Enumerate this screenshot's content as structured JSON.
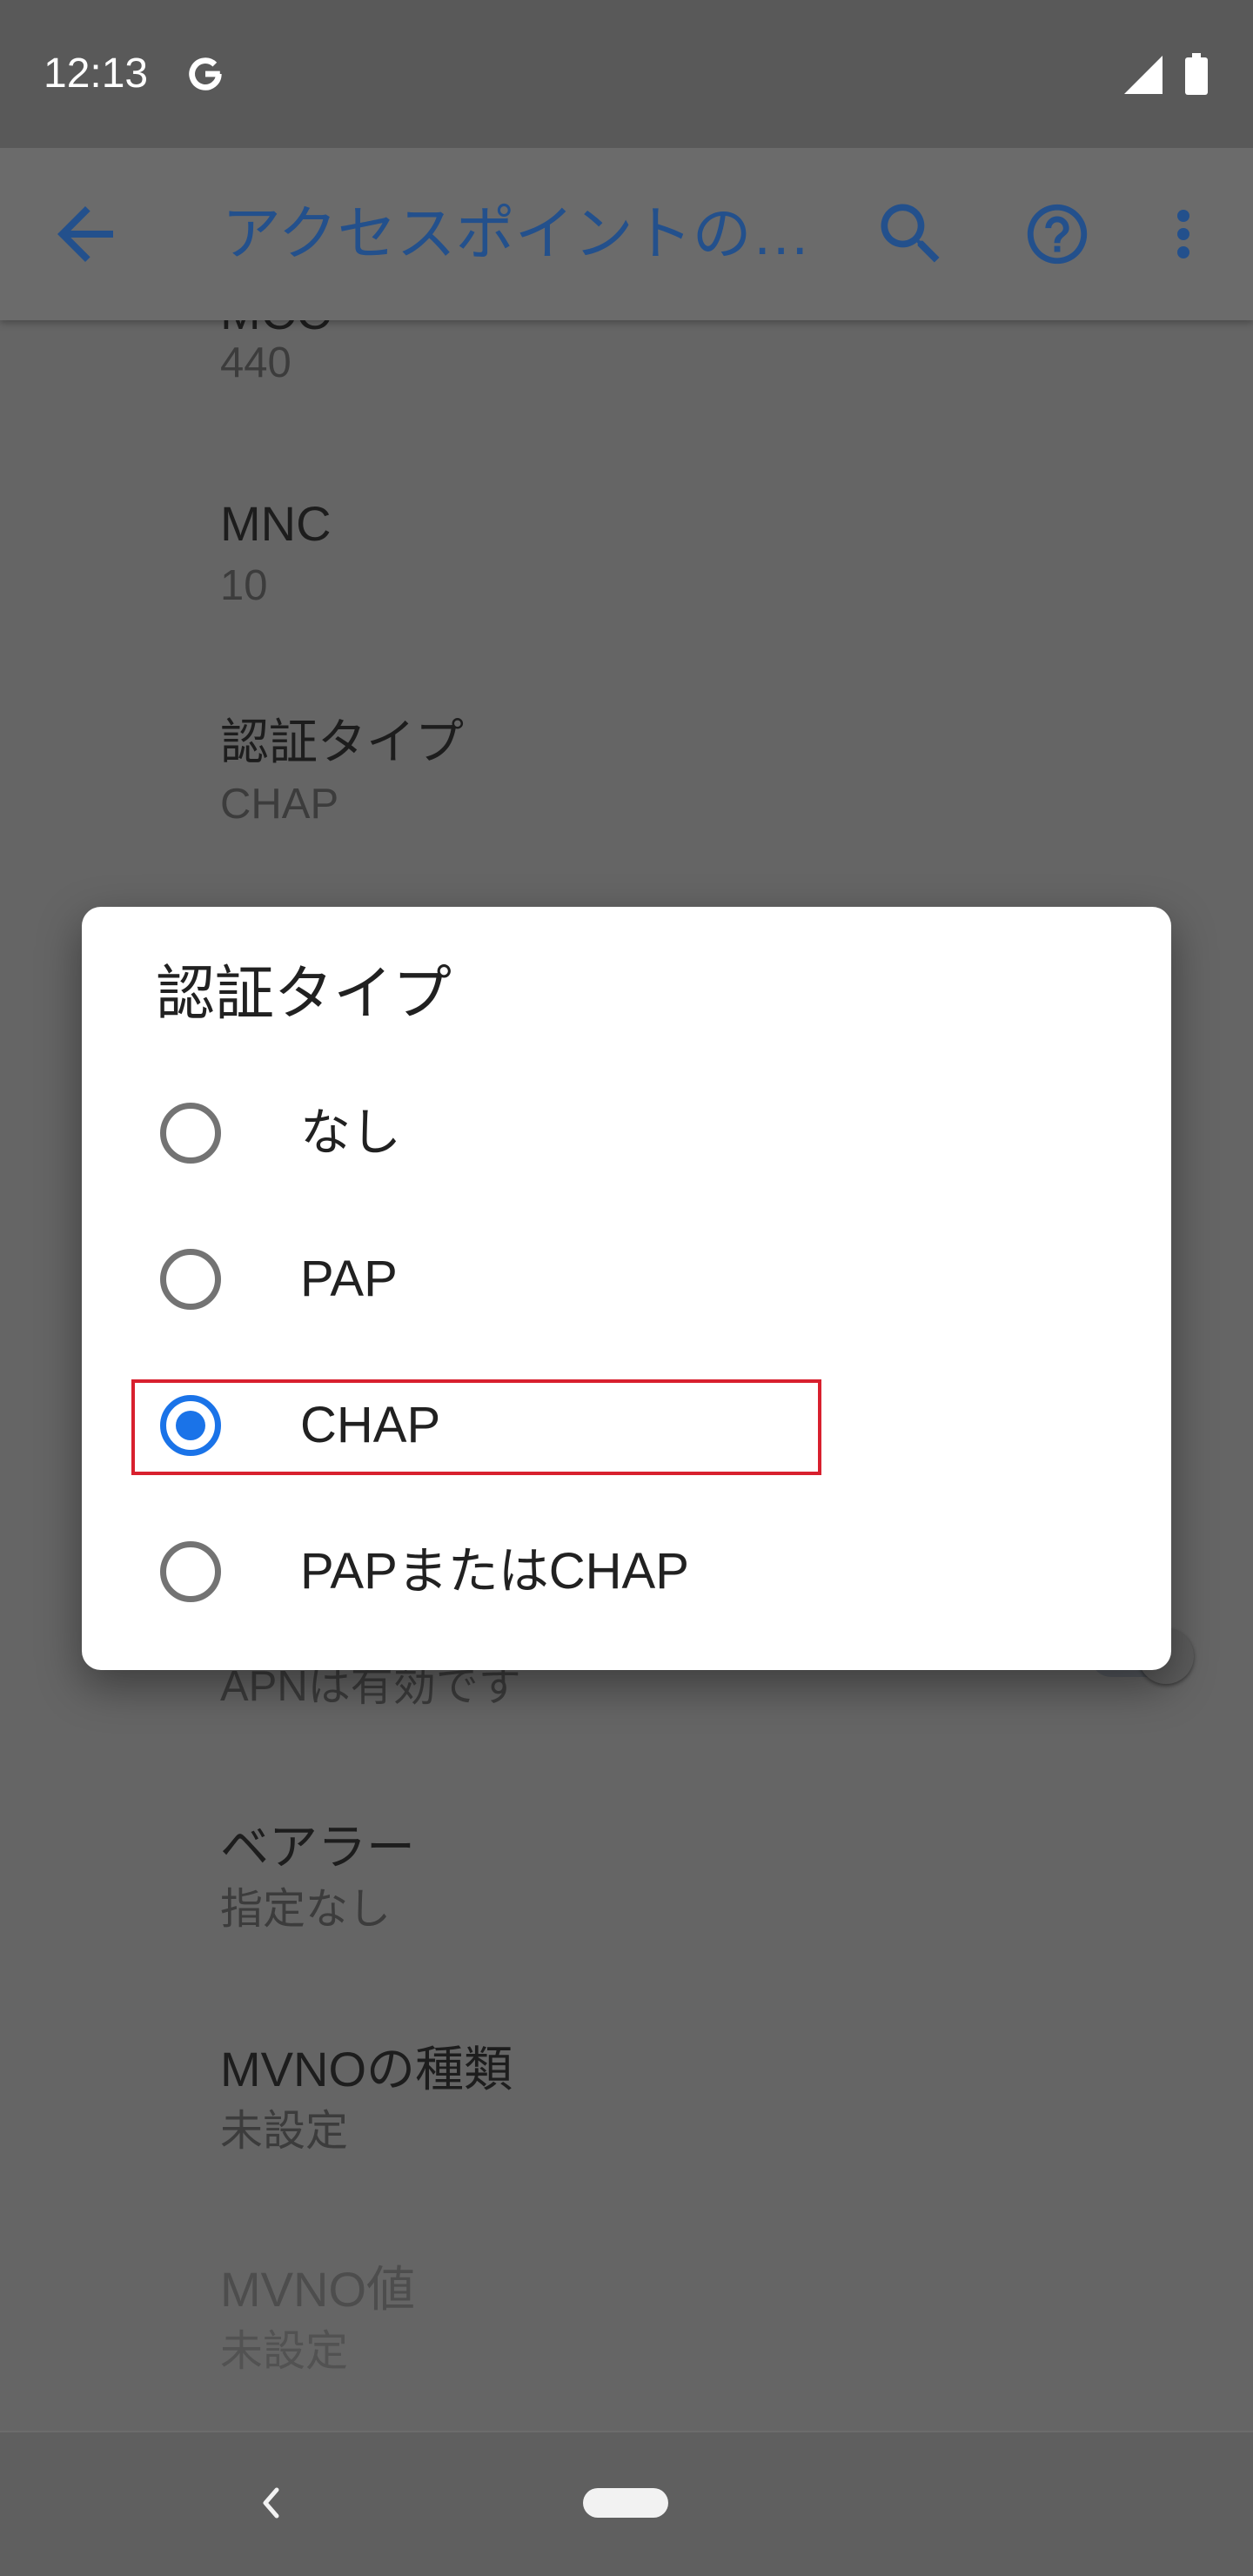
{
  "status_bar": {
    "time": "12:13",
    "icons": [
      "google-icon",
      "cell-signal-icon",
      "battery-icon"
    ]
  },
  "app_bar": {
    "title": "アクセスポイントの…",
    "back_icon": "arrow-back-icon",
    "actions": [
      "search-icon",
      "help-icon",
      "more-vert-icon"
    ]
  },
  "settings_list": [
    {
      "title": "MCC",
      "summary": "440",
      "enabled": true
    },
    {
      "title": "MNC",
      "summary": "10",
      "enabled": true
    },
    {
      "title": "認証タイプ",
      "summary": "CHAP",
      "enabled": true
    },
    {
      "summary": "APNは有効です",
      "enabled": true,
      "switch_on": true
    },
    {
      "title": "ベアラー",
      "summary": "指定なし",
      "enabled": true
    },
    {
      "title": "MVNOの種類",
      "summary": "未設定",
      "enabled": true
    },
    {
      "title": "MVNO値",
      "summary": "未設定",
      "enabled": false
    }
  ],
  "dialog": {
    "title": "認証タイプ",
    "options": [
      {
        "label": "なし",
        "selected": false
      },
      {
        "label": "PAP",
        "selected": false
      },
      {
        "label": "CHAP",
        "selected": true
      },
      {
        "label": "PAPまたはCHAP",
        "selected": false
      }
    ]
  },
  "nav_bar": {
    "icons": [
      "back-chevron-icon",
      "home-pill-icon"
    ]
  },
  "colors": {
    "accent": "#1a73e8",
    "app_bar_tint": "#23508c",
    "annotation_highlight": "#d8202e"
  }
}
